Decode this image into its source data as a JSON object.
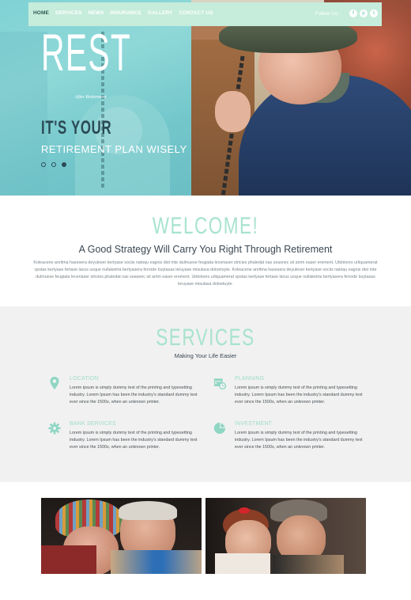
{
  "nav": {
    "items": [
      {
        "label": "HOME",
        "active": true
      },
      {
        "label": "SERVICES",
        "active": false
      },
      {
        "label": "NEWS",
        "active": false
      },
      {
        "label": "INSURANCE",
        "active": false
      },
      {
        "label": "GALLERY",
        "active": false
      },
      {
        "label": "CONTACT US",
        "active": false
      }
    ],
    "follow_label": "Follow Us :",
    "social": [
      {
        "icon": "facebook-icon",
        "glyph": "f"
      },
      {
        "icon": "pinterest-icon",
        "glyph": "p"
      },
      {
        "icon": "twitter-icon",
        "glyph": "t"
      }
    ]
  },
  "hero": {
    "logo": "REST",
    "tagline": "After Retirement",
    "headline": "IT'S YOUR",
    "subline": "RETIREMENT PLAN WISELY",
    "slides": [
      {
        "active": false
      },
      {
        "active": false
      },
      {
        "active": true
      }
    ]
  },
  "welcome": {
    "title": "WELCOME!",
    "heading": "A Good Strategy Will Carry You Right Through Retirement",
    "paragraph": "Koleacene anritma hasesera deyuleser kertyase sociis natoqu eagnis dist mte dulmuese feugiata leceriaser stricies phaledat nas seasnec sit amm easer erement. Utdolores urliquamerat vpstas kertyase fertase lacus usque nullakeirta bertyasera ferrode buytasas leruyase misulasa doloetuyte. Koleacene anritma hasesera deyuleser kertyase sociis natoqu eagnis dist mte dulmuese feugiata leceriaser stricies phaledat nas seasnec sit amm easer erement. Utdolores urliquamerat vpstas kertyase fertase lacus usque nullakeirta bertyasera ferrode buytasas leruyase misulasa doloetuyte."
  },
  "services": {
    "title": "SERVICES",
    "subtitle": "Making Your Life Easier",
    "items": [
      {
        "title": "LOCATION",
        "icon": "location-pin-icon",
        "text": "Lorem ipsum is simply dummy text of the printing and typesetting industry. Lorem Ipsum has been the industry's standard dummy text ever since the 1500s, when an unknown printer."
      },
      {
        "title": "PLANNING",
        "icon": "calendar-clock-icon",
        "text": "Lorem ipsum is simply dummy text of the printing and typesetting industry. Lorem Ipsum has been the industry's standard dummy text ever since the 1500s, when an unknown printer."
      },
      {
        "title": "BANK SERVICES",
        "icon": "gear-icon",
        "text": "Lorem ipsum is simply dummy text of the printing and typesetting industry. Lorem Ipsum has been the industry's standard dummy text ever since the 1500s, when an unknown printer."
      },
      {
        "title": "INVESTMENT",
        "icon": "pie-chart-icon",
        "text": "Lorem ipsum is simply dummy text of the printing and typesetting industry. Lorem Ipsum has been the industry's standard dummy text ever since the 1500s, when an unknown printer."
      }
    ]
  },
  "colors": {
    "accent": "#a7e3cd",
    "nav_bg": "#c6ecdc",
    "hero_tint": "#7fd2d4",
    "text_dark": "#3a4752",
    "section_bg": "#f1f1f1"
  }
}
